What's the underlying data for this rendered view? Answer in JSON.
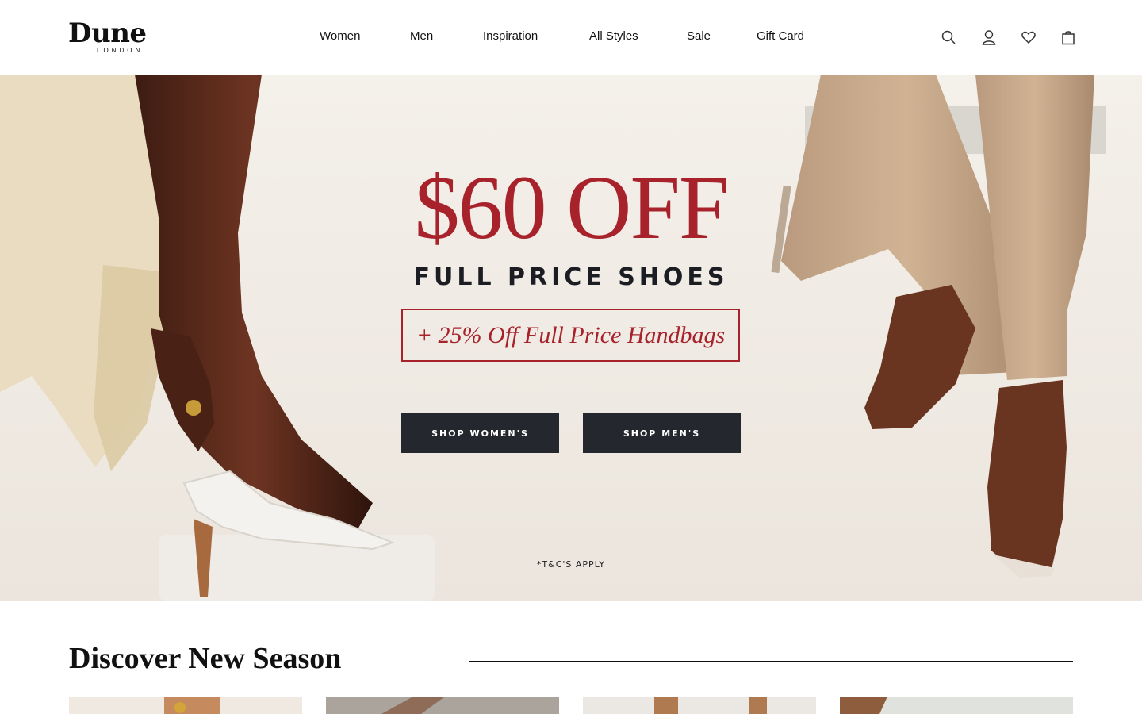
{
  "brand": {
    "name": "Dune",
    "sub": "LONDON"
  },
  "nav": [
    "Women",
    "Men",
    "Inspiration",
    "All Styles",
    "Sale",
    "Gift Card"
  ],
  "header_icons": [
    "search-icon",
    "account-icon",
    "wishlist-heart-icon",
    "shopping-bag-icon"
  ],
  "hero": {
    "headline": "$60 OFF",
    "subheadline": "FULL PRICE SHOES",
    "offer": "+ 25% Off Full Price Handbags",
    "buttons": [
      "SHOP WOMEN'S",
      "SHOP MEN'S"
    ],
    "terms": "*T&C'S APPLY"
  },
  "discover": {
    "title": "Discover New Season"
  },
  "colors": {
    "accent": "#a8222b",
    "button": "#24272d",
    "hero_bg": "#f3efe9"
  }
}
